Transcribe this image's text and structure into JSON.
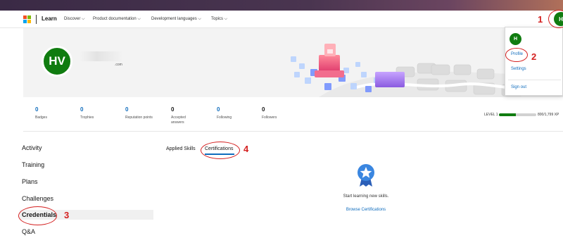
{
  "header": {
    "brand": "Learn",
    "nav": [
      "Discover ⌵",
      "Product documentation ⌵",
      "Development languages ⌵",
      "Topics ⌵"
    ],
    "avatar_initials": "H"
  },
  "profile": {
    "initials": "HV",
    "name_tail": ".com"
  },
  "stats": [
    {
      "value": "0",
      "label": "Badges"
    },
    {
      "value": "0",
      "label": "Trophies"
    },
    {
      "value": "0",
      "label": "Reputation points"
    },
    {
      "value": "0",
      "label": "Accepted answers"
    },
    {
      "value": "0",
      "label": "Following"
    },
    {
      "value": "0",
      "label": "Followers"
    }
  ],
  "level": {
    "label": "LEVEL 1",
    "xp_text": "800/1,799 XP",
    "progress_fraction": 0.445
  },
  "leftnav": [
    "Activity",
    "Training",
    "Plans",
    "Challenges",
    "Credentials",
    "Q&A"
  ],
  "tabs": [
    "Applied Skills",
    "Certifications"
  ],
  "empty_state": {
    "title": "Start learning new skills.",
    "link": "Browse Certifications"
  },
  "dropdown": {
    "avatar_initials": "H",
    "items": [
      "Profile",
      "Settings",
      "Sign out"
    ]
  },
  "annotations": [
    "1",
    "2",
    "3",
    "4"
  ],
  "colors": {
    "accent": "#0f6cbd",
    "avatar_green": "#107c10",
    "annotation_red": "#d42020"
  }
}
